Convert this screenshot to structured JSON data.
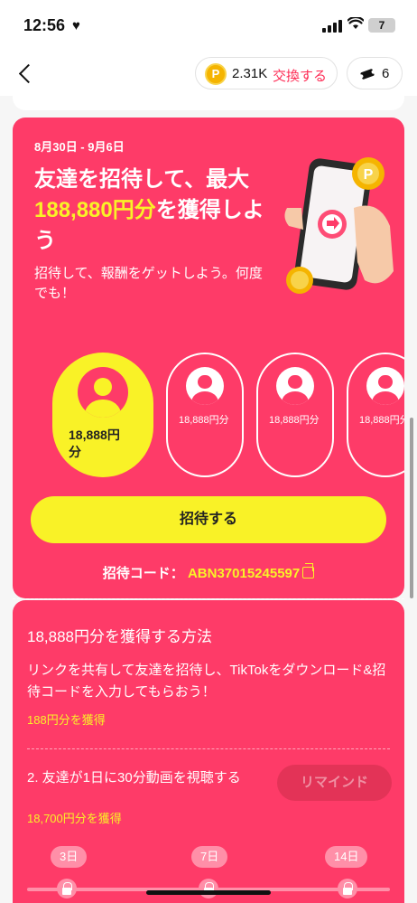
{
  "status_bar": {
    "time": "12:56",
    "battery": "7"
  },
  "header": {
    "coin_value": "2.31K",
    "exchange_label": "交換する",
    "ticket_count": "6"
  },
  "campaign": {
    "date_range": "8月30日 - 9月6日",
    "headline_pre": "友達を招待して、最大",
    "headline_highlight": "188,880円分",
    "headline_post": "を獲得しよう",
    "subtitle": "招待して、報酬をゲットしよう。何度でも！",
    "slots": [
      {
        "amount": "18,888円分"
      },
      {
        "amount": "18,888円分"
      },
      {
        "amount": "18,888円分"
      },
      {
        "amount": "18,888円分"
      }
    ],
    "invite_button": "招待する",
    "invite_code_label": "招待コード：",
    "invite_code": "ABN37015245597"
  },
  "howto": {
    "title": "18,888円分を獲得する方法",
    "step1_text": "リンクを共有して友達を招待し、TikTokをダウンロード&招待コードを入力してもらおう！",
    "step1_reward": "188円分を獲得",
    "step2_text": "2. 友達が1日に30分動画を視聴する",
    "remind_button": "リマインド",
    "step2_reward": "18,700円分を獲得",
    "days": [
      "3日",
      "7日",
      "14日"
    ]
  },
  "colors": {
    "accent": "#fe3b68",
    "highlight": "#f9f227",
    "brand_red": "#fe2c55"
  }
}
